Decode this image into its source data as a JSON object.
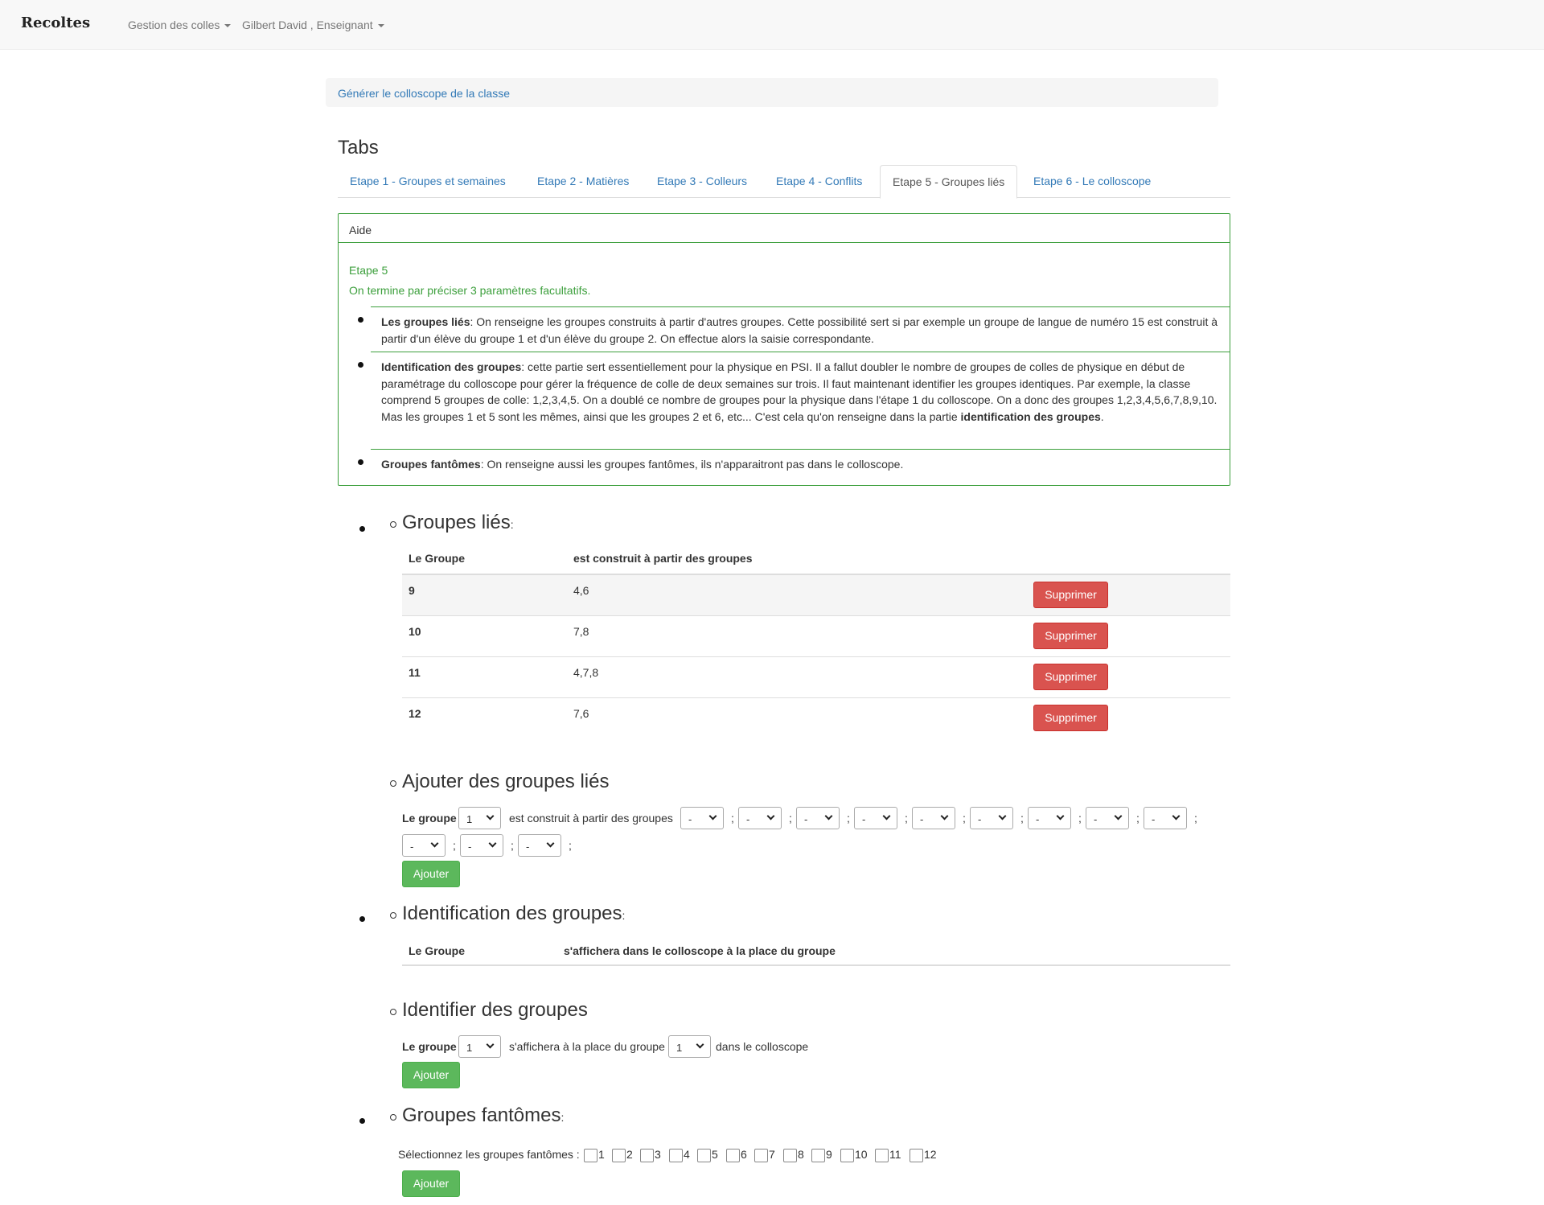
{
  "navbar": {
    "brand": "Recoltes",
    "menu_colles": "Gestion des colles",
    "menu_user": "Gilbert David , Enseignant"
  },
  "generate_link": "Générer le colloscope de la classe",
  "tabs_title": "Tabs",
  "tabs": [
    {
      "label": "Etape 1 - Groupes et semaines",
      "active": false
    },
    {
      "label": "Etape 2 - Matières",
      "active": false
    },
    {
      "label": "Etape 3 - Colleurs",
      "active": false
    },
    {
      "label": "Etape 4 - Conflits",
      "active": false
    },
    {
      "label": "Etape 5 - Groupes liés",
      "active": true
    },
    {
      "label": "Etape 6 - Le colloscope",
      "active": false
    }
  ],
  "help": {
    "heading": "Aide",
    "step": "Etape 5",
    "intro": "On termine par préciser 3 paramètres facultatifs.",
    "items": [
      {
        "title": "Les groupes liés",
        "text": ": On renseigne les groupes construits à partir d'autres groupes. Cette possibilité sert si par exemple un groupe de langue de numéro 15 est construit à partir d'un élève du groupe 1 et d'un élève du groupe 2. On effectue alors la saisie correspondante."
      },
      {
        "title": "Identification des groupes",
        "text_a": ": cette partie sert essentiellement pour la physique en PSI. Il a fallut doubler le nombre de groupes de colles de physique en début de paramétrage du colloscope pour gérer la fréquence de colle de deux semaines sur trois. Il faut maintenant identifier les groupes identiques. Par exemple, la classe comprend 5 groupes de colle: 1,2,3,4,5. On a doublé ce nombre de groupes pour la physique dans l'étape 1 du colloscope. On a donc des groupes 1,2,3,4,5,6,7,8,9,10. Mas les groupes 1 et 5 sont les mêmes, ainsi que les groupes 2 et 6, etc... C'est cela qu'on renseigne dans la partie ",
        "bold_b": "identification des groupes",
        "text_c": "."
      },
      {
        "title": "Groupes fantômes",
        "text": ": On renseigne aussi les groupes fantômes, ils n'apparaitront pas dans le colloscope."
      }
    ]
  },
  "linked_groups": {
    "heading": "Groupes liés",
    "colon": ":",
    "col_group": "Le Groupe",
    "col_built": "est construit à partir des groupes",
    "delete_label": "Supprimer",
    "rows": [
      {
        "group": "9",
        "built_from": "4,6"
      },
      {
        "group": "10",
        "built_from": "7,8"
      },
      {
        "group": "11",
        "built_from": "4,7,8"
      },
      {
        "group": "12",
        "built_from": "7,6"
      }
    ]
  },
  "add_linked": {
    "heading": "Ajouter des groupes liés",
    "label_group": "Le groupe",
    "group_value": "1",
    "label_built": "est construit à partir des groupes",
    "select_placeholder": "-",
    "separator": ";",
    "add_label": "Ajouter"
  },
  "identification": {
    "heading": "Identification des groupes",
    "colon": ":",
    "col_group": "Le Groupe",
    "col_display": "s'affichera dans le colloscope à la place du groupe"
  },
  "identify": {
    "heading": "Identifier des groupes",
    "label_group": "Le groupe",
    "group_value": "1",
    "label_instead": "s'affichera à la place du groupe",
    "instead_value": "1",
    "label_suffix": "dans le colloscope",
    "add_label": "Ajouter"
  },
  "phantom": {
    "heading": "Groupes fantômes",
    "colon": ":",
    "label": "Sélectionnez les groupes fantômes :",
    "groups": [
      "1",
      "2",
      "3",
      "4",
      "5",
      "6",
      "7",
      "8",
      "9",
      "10",
      "11",
      "12"
    ],
    "add_label": "Ajouter"
  }
}
